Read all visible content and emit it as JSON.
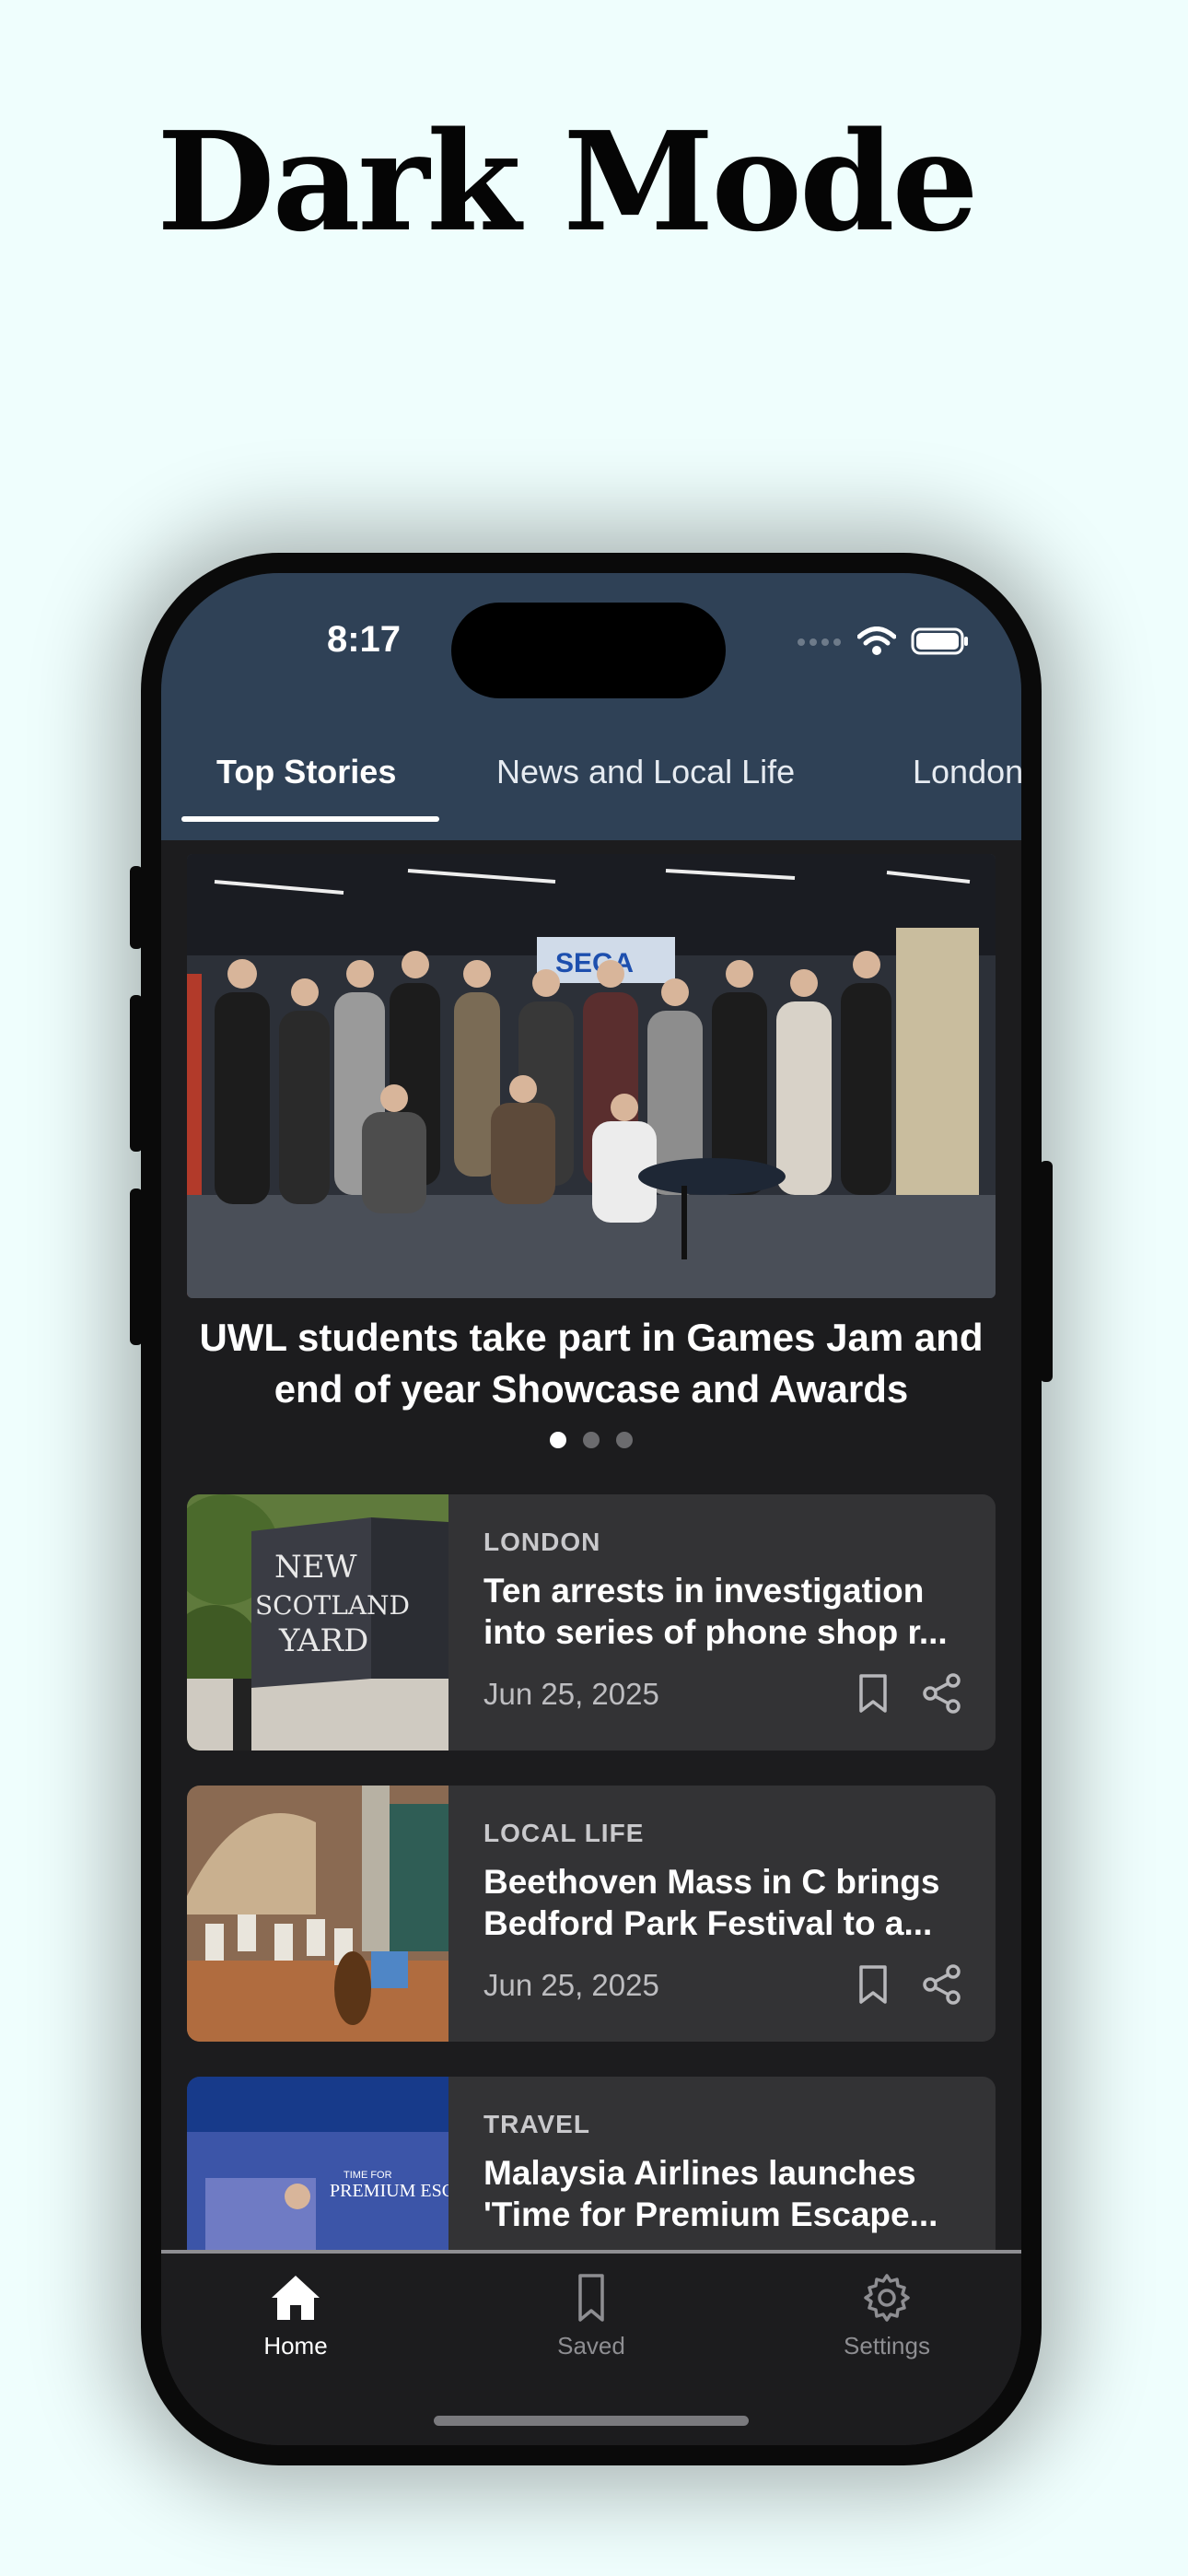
{
  "promo": {
    "headline": "Dark Mode"
  },
  "status_bar": {
    "time": "8:17"
  },
  "tabs": [
    {
      "label": "Top Stories",
      "active": true
    },
    {
      "label": "News and Local Life",
      "active": false
    },
    {
      "label": "London",
      "active": false
    }
  ],
  "hero": {
    "title_line1": "UWL students take part in Games Jam and",
    "title_line2": "end of year Showcase and Awards",
    "sign_text": "SEGA",
    "page_count": 3,
    "current_page": 1
  },
  "articles": [
    {
      "category": "LONDON",
      "title_line1": "Ten arrests in investigation",
      "title_line2": "into series of phone shop r...",
      "date": "Jun 25, 2025",
      "thumb_sign": [
        "NEW",
        "SCOTLAND",
        "YARD"
      ]
    },
    {
      "category": "LOCAL LIFE",
      "title_line1": "Beethoven Mass in C brings",
      "title_line2": "Bedford Park Festival to a...",
      "date": "Jun 25, 2025"
    },
    {
      "category": "TRAVEL",
      "title_line1": "Malaysia Airlines launches",
      "title_line2": "'Time for Premium Escape...",
      "thumb_text_top": "TIME FOR",
      "thumb_text_main": "PREMIUM ESCA"
    }
  ],
  "tabbar": {
    "home_label": "Home",
    "saved_label": "Saved",
    "settings_label": "Settings",
    "active": "Home"
  },
  "colors": {
    "page_bg": "#effefd",
    "header_bg": "#2f4156",
    "screen_bg": "#1c1c1e",
    "card_bg": "#333335"
  },
  "icons": [
    "wifi-icon",
    "battery-icon",
    "bookmark-icon",
    "share-icon",
    "home-icon",
    "settings-gear-icon"
  ]
}
